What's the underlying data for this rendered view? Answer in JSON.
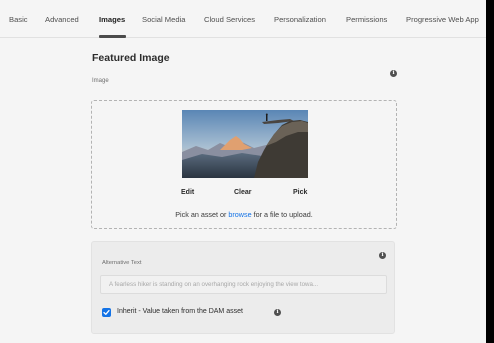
{
  "tabs": [
    {
      "label": "Basic"
    },
    {
      "label": "Advanced"
    },
    {
      "label": "Images"
    },
    {
      "label": "Social Media"
    },
    {
      "label": "Cloud Services"
    },
    {
      "label": "Personalization"
    },
    {
      "label": "Permissions"
    },
    {
      "label": "Progressive Web App"
    }
  ],
  "active_tab": "Images",
  "section": {
    "title": "Featured Image"
  },
  "image_field": {
    "label": "Image",
    "info_icon": "i",
    "actions": {
      "edit": "Edit",
      "clear": "Clear",
      "pick": "Pick"
    },
    "hint_before": "Pick an asset or ",
    "hint_link": "browse",
    "hint_after": " for a file to upload."
  },
  "alt_text": {
    "label": "Alternative Text",
    "info_icon": "i",
    "placeholder": "A fearless hiker is standing on an overhanging rock enjoying the view towa...",
    "inherit_label": "Inherit - Value taken from the DAM asset",
    "inherit_checked": true
  },
  "colors": {
    "accent": "#1473e6",
    "background": "#f5f5f5",
    "text": "#2c2c2c"
  },
  "icons": [
    "info-icon",
    "checkmark-icon"
  ]
}
